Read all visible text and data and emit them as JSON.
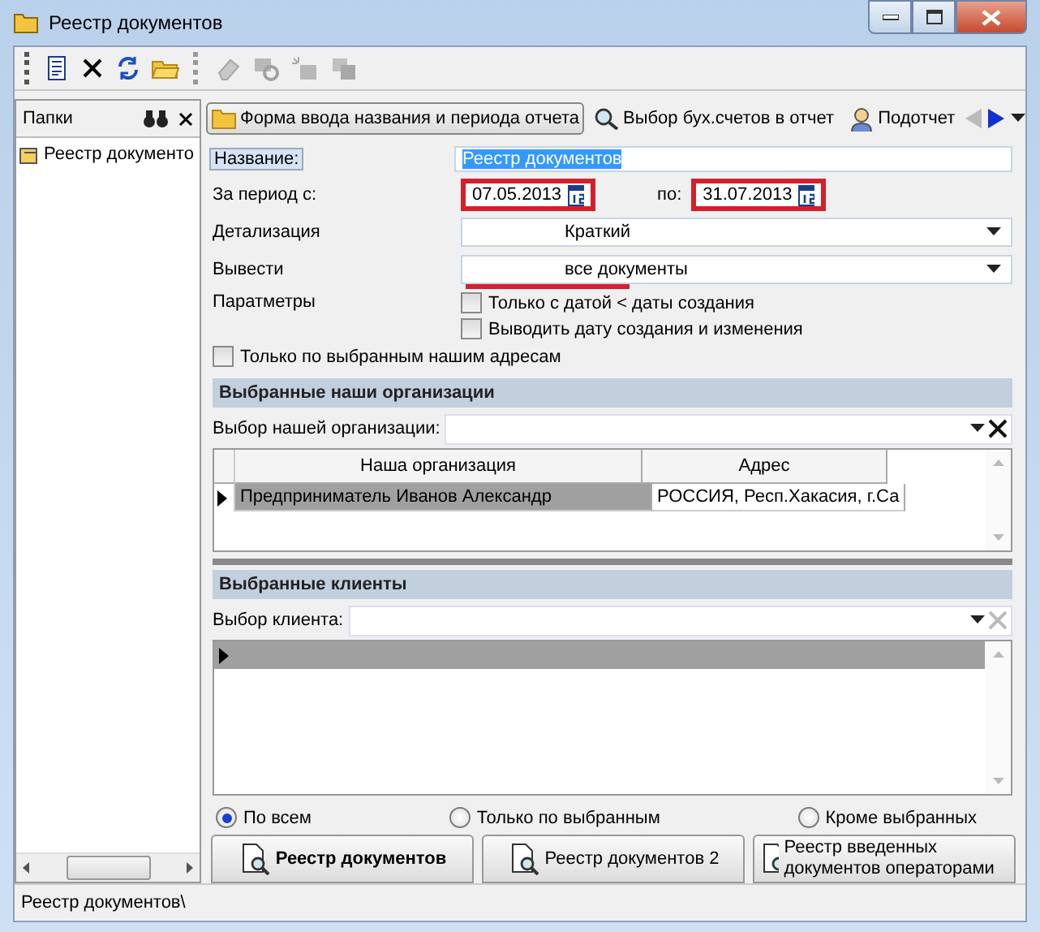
{
  "window": {
    "title": "Реестр документов"
  },
  "toolbar": [
    {
      "kind": "document",
      "disabled": false
    },
    {
      "kind": "delete",
      "disabled": false
    },
    {
      "kind": "refresh",
      "disabled": false
    },
    {
      "kind": "folder",
      "disabled": false
    },
    {
      "kind": "eraser",
      "disabled": true
    },
    {
      "kind": "stamp",
      "disabled": true
    },
    {
      "kind": "spark",
      "disabled": true
    },
    {
      "kind": "copy",
      "disabled": true
    }
  ],
  "folders_panel": {
    "title": "Папки",
    "items": [
      {
        "label": "Реестр документо",
        "selected": false
      }
    ]
  },
  "tabs": [
    {
      "label": "Форма ввода названия и периода отчета",
      "selected": true
    },
    {
      "label": "Выбор бух.счетов в отчет",
      "selected": false
    },
    {
      "label": "Подотчет",
      "selected": false
    }
  ],
  "form": {
    "name_label": "Название:",
    "name_value": "Реестр документов",
    "period_label": "За период с:",
    "date_from": {
      "value": "07.05.2013",
      "highlighted": true
    },
    "to_label": "по:",
    "date_to": {
      "value": "31.07.2013",
      "highlighted": true
    },
    "detail_label": "Детализация",
    "detail_value": "Краткий",
    "output_label": "Вывести",
    "output": {
      "value": "все документы",
      "underlined": true
    },
    "params_label": "Паратметры",
    "options": [
      {
        "label": "Только с датой < даты создания",
        "checked": false
      },
      {
        "label": "Выводить дату создания и изменения",
        "checked": false
      }
    ],
    "only_our_addresses": {
      "label": "Только по выбранным нашим адресам",
      "checked": false
    }
  },
  "organizations": {
    "title": "Выбранные наши организации",
    "picker_label": "Выбор нашей организации:",
    "columns": [
      "Наша организация",
      "Адрес"
    ],
    "rows": [
      {
        "cells": [
          "Предприниматель Иванов Александр",
          "РОССИЯ, Респ.Хакасия, г.Са"
        ],
        "selected": true
      }
    ]
  },
  "clients": {
    "title": "Выбранные клиенты",
    "picker_label": "Выбор клиента:",
    "rows": [
      {
        "selected": true
      }
    ]
  },
  "filter": [
    {
      "label": "По всем",
      "selected": true
    },
    {
      "label": "Только по выбранным",
      "selected": false
    },
    {
      "label": "Кроме выбранных",
      "selected": false
    }
  ],
  "buttons": [
    {
      "label": "Реестр документов",
      "default": true
    },
    {
      "label": "Реестр документов 2",
      "default": false
    },
    {
      "label": "Реестр введенных документов операторами",
      "default": false
    }
  ],
  "status_bar": "Реестр документов\\"
}
